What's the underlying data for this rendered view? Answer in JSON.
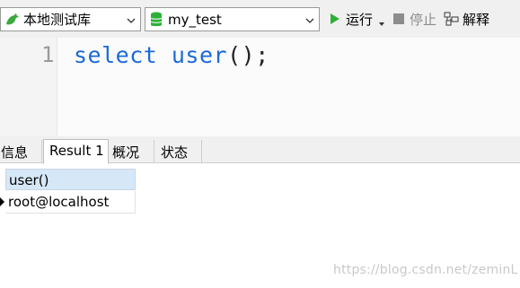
{
  "toolbar": {
    "connection": {
      "label": "本地测试库",
      "icon": "dolphin-icon"
    },
    "database": {
      "label": "my_test",
      "icon": "database-icon"
    },
    "run_label": "运行",
    "stop_label": "停止",
    "explain_label": "解释"
  },
  "editor": {
    "line_number": "1",
    "code": {
      "keyword1": "select",
      "space": " ",
      "keyword2": "user",
      "punct": "();"
    }
  },
  "tabs": [
    {
      "label": "信息"
    },
    {
      "label": "Result 1",
      "active": true
    },
    {
      "label": "概况"
    },
    {
      "label": "状态"
    }
  ],
  "grid": {
    "columns": [
      "user()"
    ],
    "rows": [
      [
        "root@localhost"
      ]
    ]
  },
  "watermark": "https://blog.csdn.net/zeminL",
  "colors": {
    "keyword": "#1b6ad8",
    "header_bg": "#d6e7f7",
    "run_green": "#2eaf3a"
  }
}
